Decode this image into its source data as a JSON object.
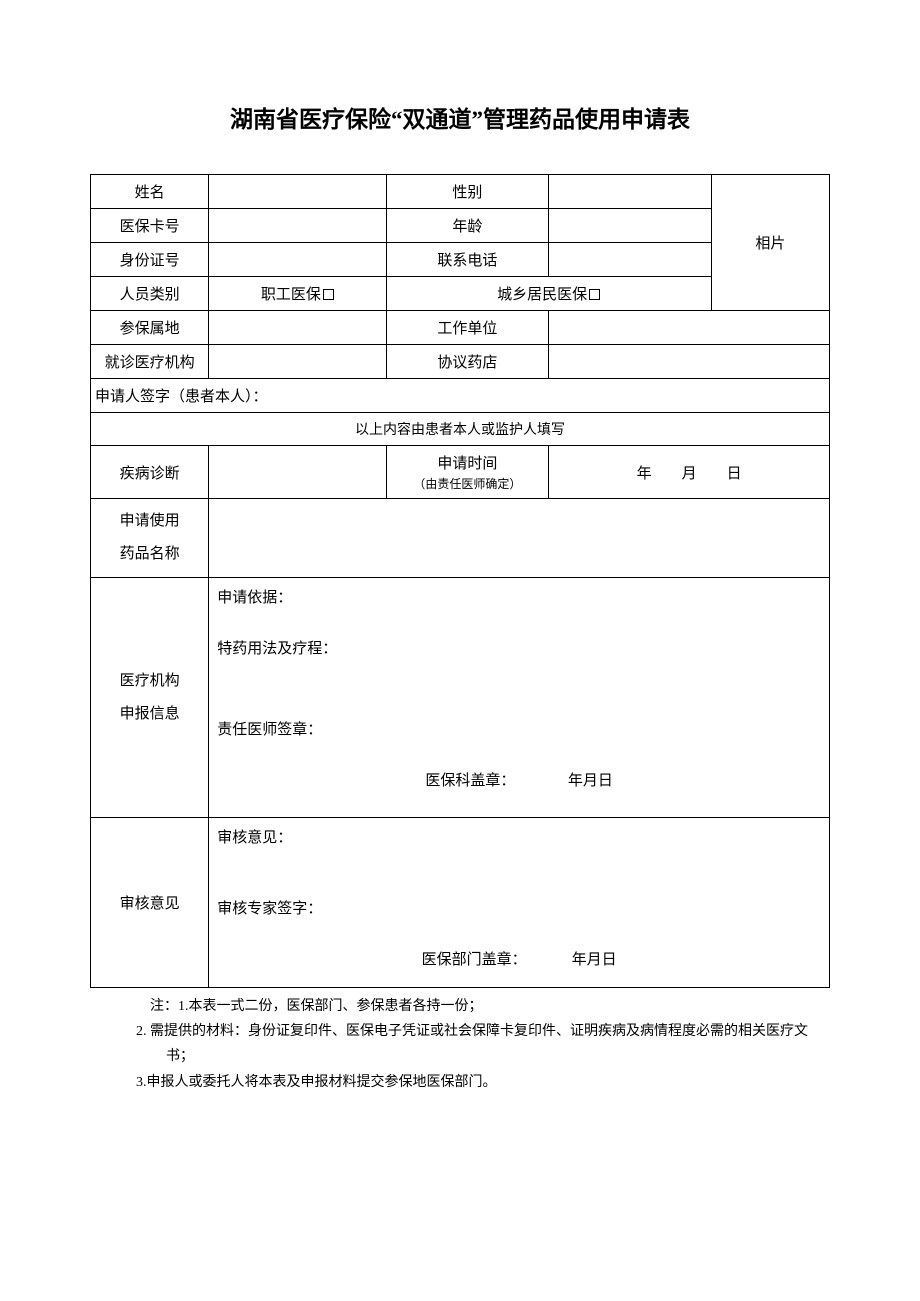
{
  "title": "湖南省医疗保险“双通道”管理药品使用申请表",
  "labels": {
    "name": "姓名",
    "gender": "性别",
    "card": "医保卡号",
    "age": "年龄",
    "idno": "身份证号",
    "phone": "联系电话",
    "category": "人员类别",
    "opt_employee": "职工医保",
    "opt_resident": "城乡居民医保",
    "photo": "相片",
    "insured_area": "参保属地",
    "work_unit": "工作单位",
    "hospital": "就诊医疗机构",
    "pharmacy": "协议药店",
    "applicant_sign": "申请人签字（患者本人）：",
    "section_patient": "以上内容由患者本人或监护人填写",
    "diagnosis": "疾病诊断",
    "apply_time": "申请时间",
    "apply_time_note": "（由责任医师确定）",
    "drug_name_l1": "申请使用",
    "drug_name_l2": "药品名称",
    "inst_info_l1": "医疗机构",
    "inst_info_l2": "申报信息",
    "basis": "申请依据：",
    "usage": "特药用法及疗程：",
    "doctor_sign": "责任医师签章：",
    "dept_stamp": "医保科盖章：",
    "review": "审核意见",
    "review_opinion": "审核意见：",
    "expert_sign": "审核专家签字：",
    "bureau_stamp": "医保部门盖章：",
    "ymd_long": "年  月  日",
    "ymd_short": "年月日"
  },
  "values": {
    "name": "",
    "gender": "",
    "card": "",
    "age": "",
    "idno": "",
    "phone": "",
    "insured_area": "",
    "work_unit": "",
    "hospital": "",
    "pharmacy": "",
    "diagnosis": "",
    "drug_name": "",
    "basis": "",
    "usage": "",
    "review_opinion": ""
  },
  "notes": {
    "n1": "注：1.本表一式二份，医保部门、参保患者各持一份；",
    "n2": "2. 需提供的材料：身份证复印件、医保电子凭证或社会保障卡复印件、证明疾病及病情程度必需的相关医疗文书；",
    "n3": "3.申报人或委托人将本表及申报材料提交参保地医保部门。"
  }
}
